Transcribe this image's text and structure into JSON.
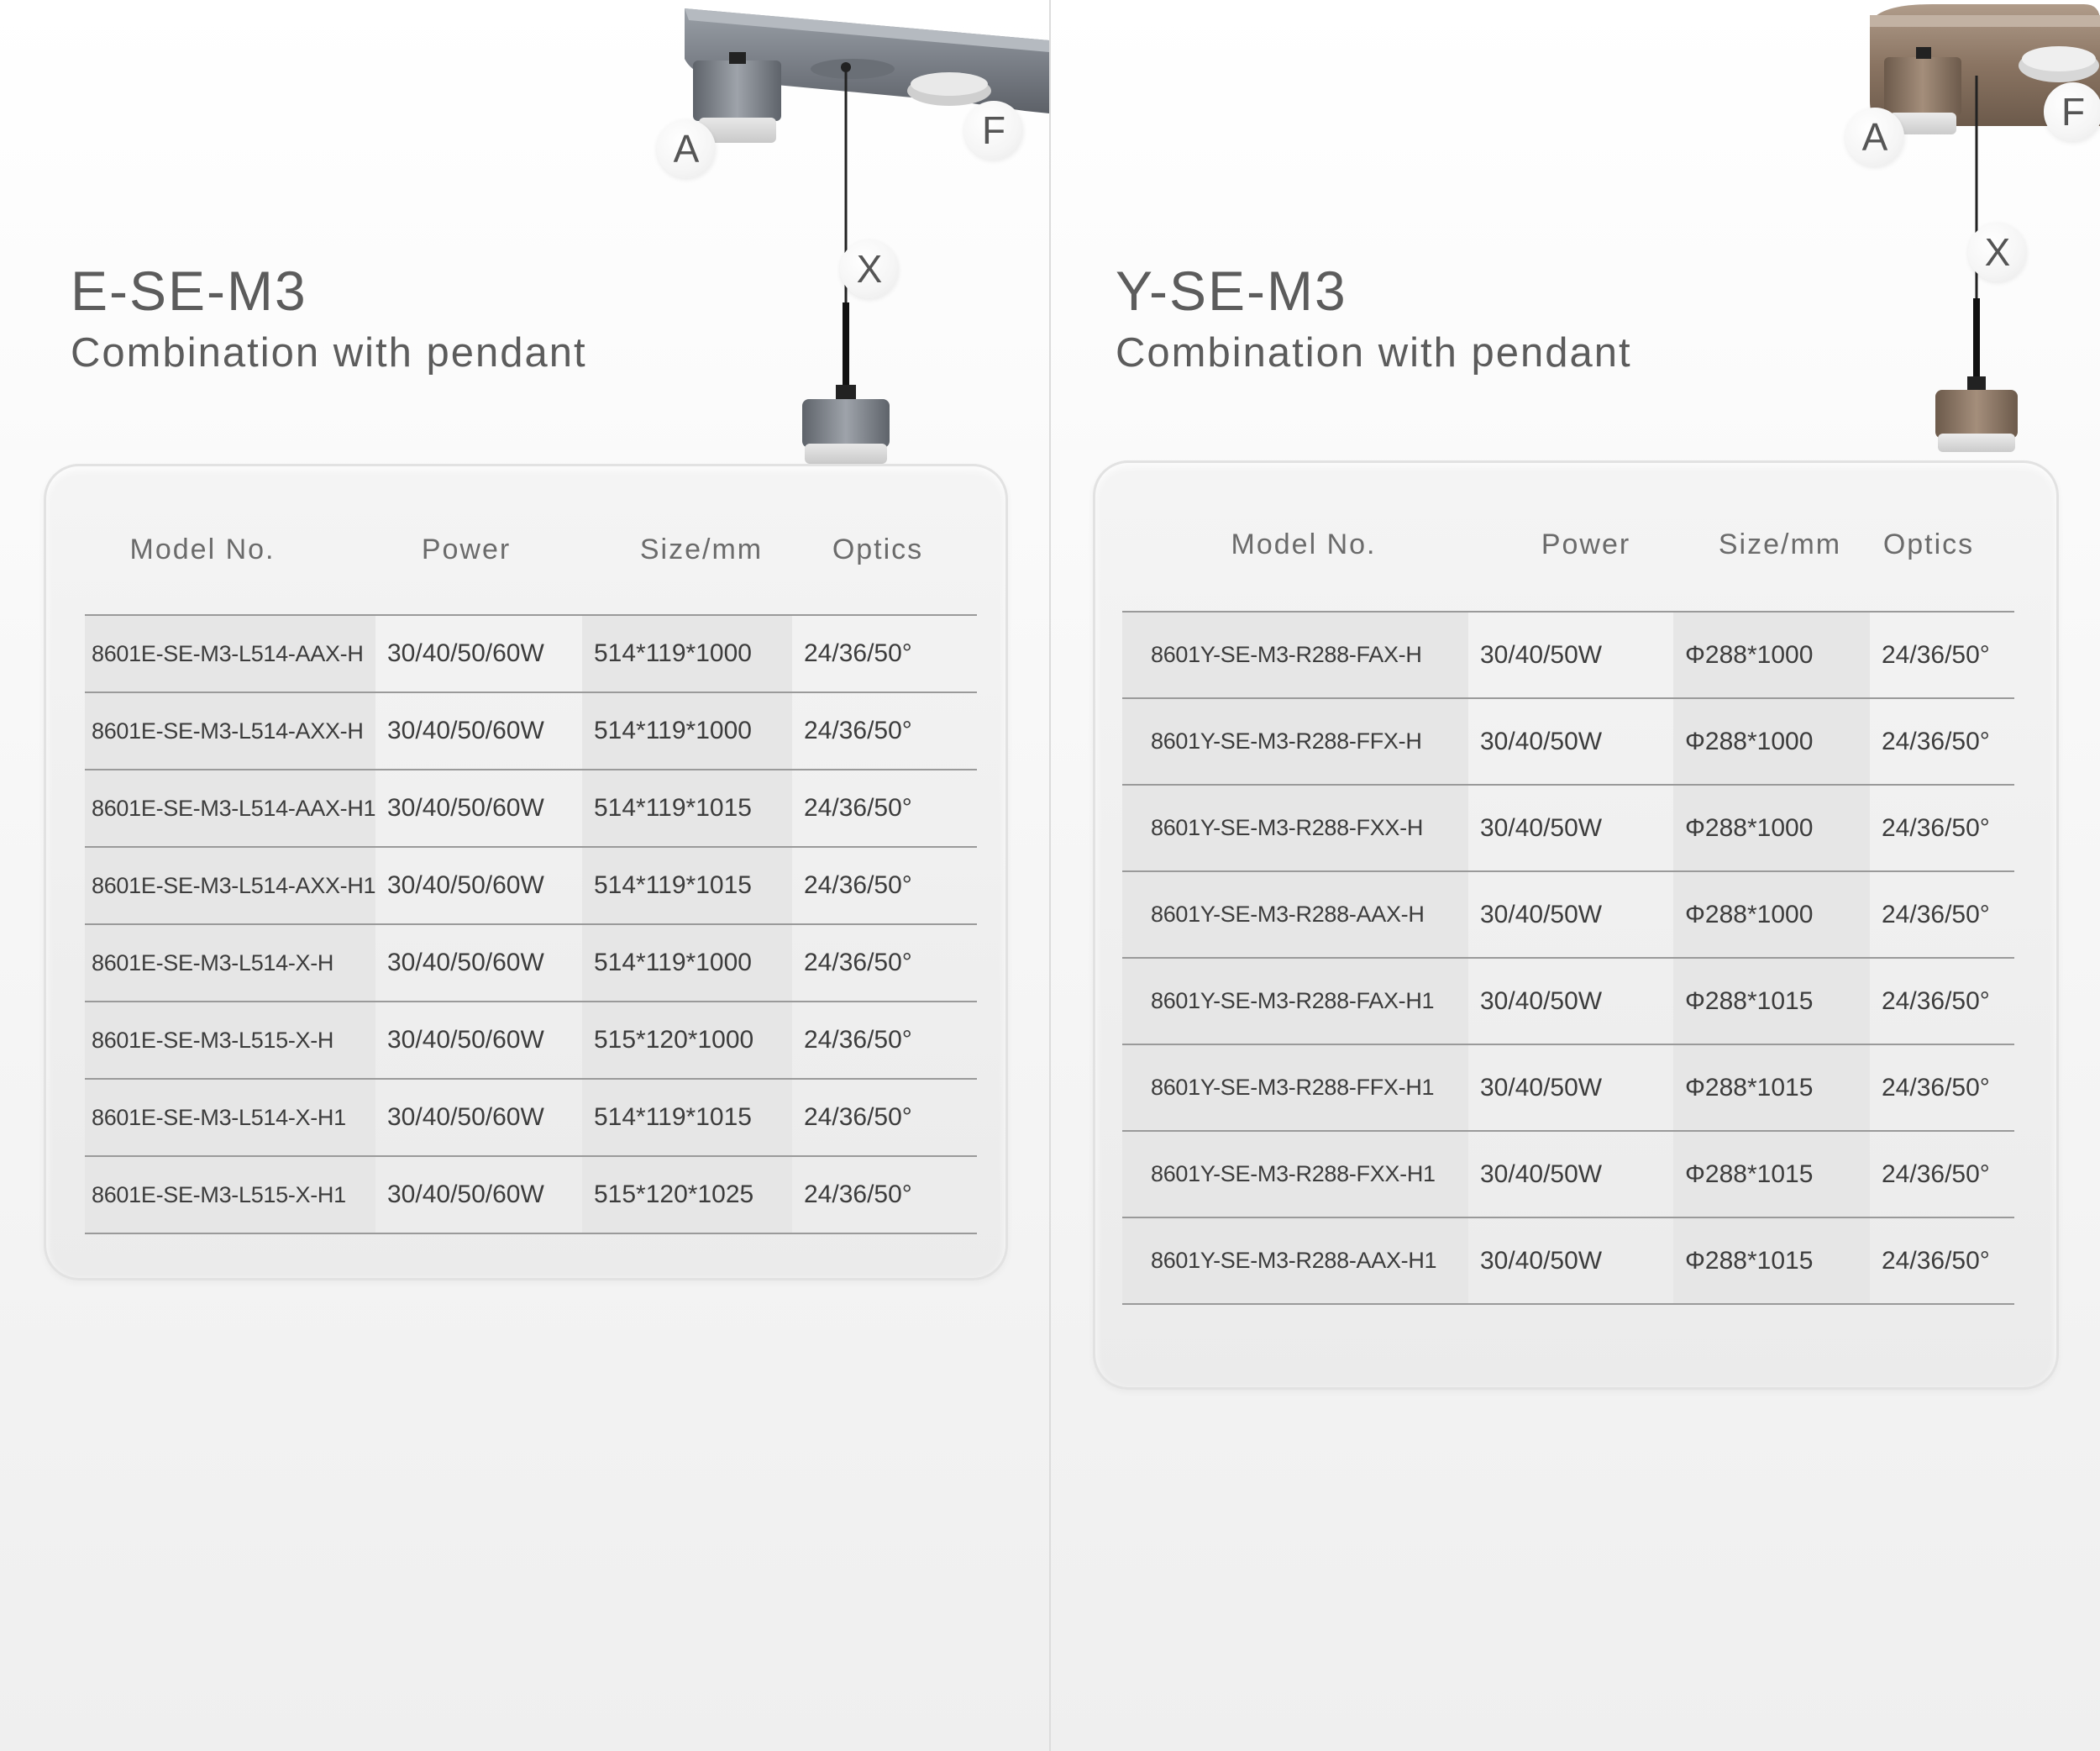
{
  "panels": [
    {
      "title": "E-SE-M3",
      "subtitle": "Combination with pendant",
      "labels": {
        "a": "A",
        "f": "F",
        "x": "X"
      },
      "headers": {
        "model": "Model No.",
        "power": "Power",
        "size": "Size/mm",
        "optics": "Optics"
      },
      "rows": [
        {
          "model": "8601E-SE-M3-L514-AAX-H",
          "power": "30/40/50/60W",
          "size": "514*119*1000",
          "optics": "24/36/50°"
        },
        {
          "model": "8601E-SE-M3-L514-AXX-H",
          "power": "30/40/50/60W",
          "size": "514*119*1000",
          "optics": "24/36/50°"
        },
        {
          "model": "8601E-SE-M3-L514-AAX-H1",
          "power": "30/40/50/60W",
          "size": "514*119*1015",
          "optics": "24/36/50°"
        },
        {
          "model": "8601E-SE-M3-L514-AXX-H1",
          "power": "30/40/50/60W",
          "size": "514*119*1015",
          "optics": "24/36/50°"
        },
        {
          "model": "8601E-SE-M3-L514-X-H",
          "power": "30/40/50/60W",
          "size": "514*119*1000",
          "optics": "24/36/50°"
        },
        {
          "model": "8601E-SE-M3-L515-X-H",
          "power": "30/40/50/60W",
          "size": "515*120*1000",
          "optics": "24/36/50°"
        },
        {
          "model": "8601E-SE-M3-L514-X-H1",
          "power": "30/40/50/60W",
          "size": "514*119*1015",
          "optics": "24/36/50°"
        },
        {
          "model": "8601E-SE-M3-L515-X-H1",
          "power": "30/40/50/60W",
          "size": "515*120*1025",
          "optics": "24/36/50°"
        }
      ]
    },
    {
      "title": "Y-SE-M3",
      "subtitle": "Combination with pendant",
      "labels": {
        "a": "A",
        "f": "F",
        "x": "X"
      },
      "headers": {
        "model": "Model No.",
        "power": "Power",
        "size": "Size/mm",
        "optics": "Optics"
      },
      "rows": [
        {
          "model": "8601Y-SE-M3-R288-FAX-H",
          "power": "30/40/50W",
          "size": "Φ288*1000",
          "optics": "24/36/50°"
        },
        {
          "model": "8601Y-SE-M3-R288-FFX-H",
          "power": "30/40/50W",
          "size": "Φ288*1000",
          "optics": "24/36/50°"
        },
        {
          "model": "8601Y-SE-M3-R288-FXX-H",
          "power": "30/40/50W",
          "size": "Φ288*1000",
          "optics": "24/36/50°"
        },
        {
          "model": "8601Y-SE-M3-R288-AAX-H",
          "power": "30/40/50W",
          "size": "Φ288*1000",
          "optics": "24/36/50°"
        },
        {
          "model": "8601Y-SE-M3-R288-FAX-H1",
          "power": "30/40/50W",
          "size": "Φ288*1015",
          "optics": "24/36/50°"
        },
        {
          "model": "8601Y-SE-M3-R288-FFX-H1",
          "power": "30/40/50W",
          "size": "Φ288*1015",
          "optics": "24/36/50°"
        },
        {
          "model": "8601Y-SE-M3-R288-FXX-H1",
          "power": "30/40/50W",
          "size": "Φ288*1015",
          "optics": "24/36/50°"
        },
        {
          "model": "8601Y-SE-M3-R288-AAX-H1",
          "power": "30/40/50W",
          "size": "Φ288*1015",
          "optics": "24/36/50°"
        }
      ]
    }
  ],
  "colors": {
    "left_fixture_finish": "#7b8088",
    "right_fixture_finish": "#8a7462"
  }
}
